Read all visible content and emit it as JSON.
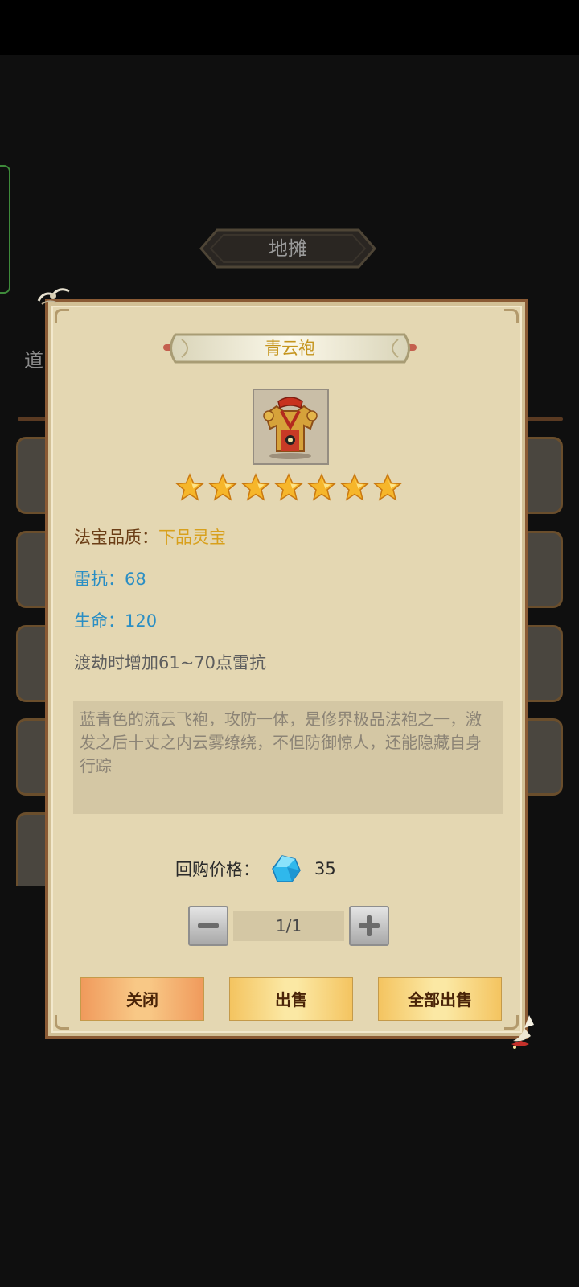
{
  "background": {
    "title": "地摊",
    "tab_fragment": "道"
  },
  "item": {
    "name": "青云袍",
    "icon": "golden-robe-icon",
    "stars": 7,
    "star_icon": "star-icon",
    "quality_label": "法宝品质：",
    "quality_value": "下品灵宝",
    "thunder_resist": "雷抗：68",
    "life": "生命：120",
    "effect": "渡劫时增加61~70点雷抗",
    "description": "蓝青色的流云飞袍，攻防一体，是修界极品法袍之一，激发之后十丈之内云雾缭绕，不但防御惊人，还能隐藏自身行踪"
  },
  "price": {
    "label": "回购价格：",
    "currency_icon": "blue-gem-icon",
    "amount": "35"
  },
  "quantity": {
    "value": "1/1"
  },
  "buttons": {
    "close": "关闭",
    "sell": "出售",
    "sell_all": "全部出售"
  },
  "colors": {
    "quality_value": "#d8a01c",
    "stat_blue": "#2a8ec4",
    "name_gold": "#c5951e"
  }
}
